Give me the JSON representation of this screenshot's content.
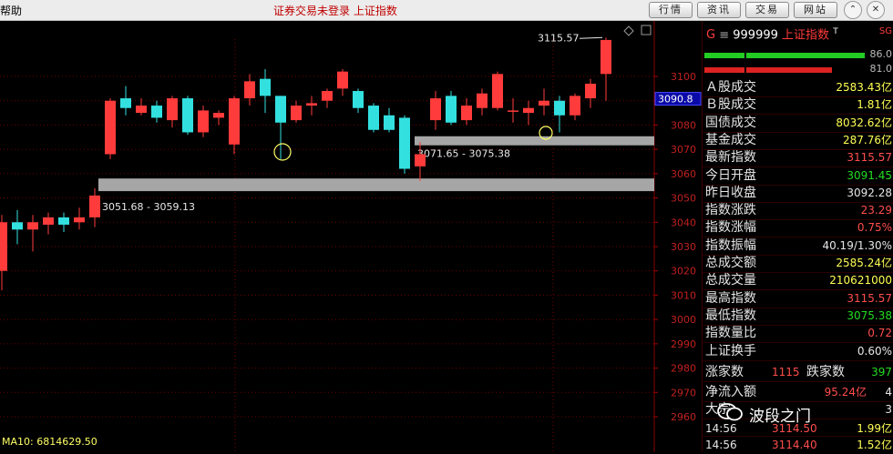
{
  "app": {
    "menu_help": "帮助",
    "status_text": "证券交易未登录 上证指数",
    "buttons": [
      "行情",
      "资讯",
      "交易",
      "网站"
    ]
  },
  "chart": {
    "y_axis_ticks": [
      "3100",
      "3090",
      "3080",
      "3070",
      "3060",
      "3050",
      "3040",
      "3030",
      "3020",
      "3010",
      "3000",
      "2990",
      "2980",
      "2970",
      "2960"
    ],
    "current_price_tag": "3090.8",
    "high_label": "3115.57",
    "zone_labels": [
      "3051.68 - 3059.13",
      "3071.65 - 3075.38"
    ],
    "ma_label": "MA10: 6814629.50",
    "colors": {
      "up": "#ff3b3b",
      "down": "#33e0e0",
      "zone": "#a6a6a6",
      "grid": "#6b0000"
    }
  },
  "chart_data": {
    "type": "candlestick",
    "ylim": [
      2955,
      3120
    ],
    "candles": [
      {
        "o": 3020,
        "c": 3040,
        "h": 3043,
        "l": 3012
      },
      {
        "o": 3040,
        "c": 3037,
        "h": 3045,
        "l": 3031
      },
      {
        "o": 3037,
        "c": 3040,
        "h": 3043,
        "l": 3028
      },
      {
        "o": 3039,
        "c": 3042,
        "h": 3044,
        "l": 3035
      },
      {
        "o": 3042,
        "c": 3039,
        "h": 3044,
        "l": 3036
      },
      {
        "o": 3040,
        "c": 3042,
        "h": 3046,
        "l": 3037
      },
      {
        "o": 3042,
        "c": 3051,
        "h": 3054,
        "l": 3038
      },
      {
        "o": 3068,
        "c": 3090,
        "h": 3091,
        "l": 3066
      },
      {
        "o": 3091,
        "c": 3087,
        "h": 3096,
        "l": 3084
      },
      {
        "o": 3085,
        "c": 3088,
        "h": 3091,
        "l": 3084
      },
      {
        "o": 3088,
        "c": 3083,
        "h": 3090,
        "l": 3081
      },
      {
        "o": 3082,
        "c": 3091,
        "h": 3092,
        "l": 3079
      },
      {
        "o": 3091,
        "c": 3077,
        "h": 3092,
        "l": 3076
      },
      {
        "o": 3077,
        "c": 3086,
        "h": 3088,
        "l": 3075
      },
      {
        "o": 3083,
        "c": 3085,
        "h": 3086,
        "l": 3080
      },
      {
        "o": 3072,
        "c": 3091,
        "h": 3092,
        "l": 3068
      },
      {
        "o": 3091,
        "c": 3098,
        "h": 3101,
        "l": 3088
      },
      {
        "o": 3099,
        "c": 3092,
        "h": 3103,
        "l": 3085
      },
      {
        "o": 3092,
        "c": 3081,
        "h": 3092,
        "l": 3066
      },
      {
        "o": 3082,
        "c": 3088,
        "h": 3090,
        "l": 3081
      },
      {
        "o": 3088,
        "c": 3089,
        "h": 3092,
        "l": 3084
      },
      {
        "o": 3090,
        "c": 3094,
        "h": 3095,
        "l": 3087
      },
      {
        "o": 3095,
        "c": 3102,
        "h": 3103,
        "l": 3092
      },
      {
        "o": 3094,
        "c": 3087,
        "h": 3095,
        "l": 3085
      },
      {
        "o": 3088,
        "c": 3078,
        "h": 3089,
        "l": 3077
      },
      {
        "o": 3084,
        "c": 3078,
        "h": 3087,
        "l": 3077
      },
      {
        "o": 3083,
        "c": 3062,
        "h": 3084,
        "l": 3060
      },
      {
        "o": 3063,
        "c": 3068,
        "h": 3073,
        "l": 3057
      },
      {
        "o": 3082,
        "c": 3091,
        "h": 3094,
        "l": 3078
      },
      {
        "o": 3092,
        "c": 3081,
        "h": 3094,
        "l": 3080
      },
      {
        "o": 3082,
        "c": 3088,
        "h": 3091,
        "l": 3080
      },
      {
        "o": 3087,
        "c": 3093,
        "h": 3095,
        "l": 3084
      },
      {
        "o": 3087,
        "c": 3101,
        "h": 3102,
        "l": 3086
      },
      {
        "o": 3086,
        "c": 3086,
        "h": 3091,
        "l": 3081
      },
      {
        "o": 3085,
        "c": 3087,
        "h": 3090,
        "l": 3080
      },
      {
        "o": 3088,
        "c": 3090,
        "h": 3095,
        "l": 3084
      },
      {
        "o": 3090,
        "c": 3084,
        "h": 3092,
        "l": 3077
      },
      {
        "o": 3084,
        "c": 3092,
        "h": 3093,
        "l": 3082
      },
      {
        "o": 3091,
        "c": 3097,
        "h": 3099,
        "l": 3087
      },
      {
        "o": 3101,
        "c": 3115,
        "h": 3116,
        "l": 3090
      }
    ],
    "zones": [
      {
        "low": 3051.68,
        "high": 3059.13,
        "label": "3051.68 - 3059.13"
      },
      {
        "low": 3071.65,
        "high": 3075.38,
        "label": "3071.65 - 3075.38"
      }
    ]
  },
  "panel": {
    "header": {
      "prefix": "G",
      "menu_icon": "≡",
      "code": "999999",
      "name": "上证指数",
      "superscript": "T",
      "badge": "SG"
    },
    "bars": [
      {
        "value": "86.0"
      },
      {
        "value": "81.0"
      }
    ],
    "rows": [
      {
        "label": "Ａ股成交",
        "value": "2583.43亿",
        "cls": "yl"
      },
      {
        "label": "Ｂ股成交",
        "value": "1.81亿",
        "cls": "yl"
      },
      {
        "label": "国债成交",
        "value": "8032.62亿",
        "cls": "yl"
      },
      {
        "label": "基金成交",
        "value": "287.76亿",
        "cls": "yl"
      },
      {
        "label": "最新指数",
        "value": "3115.57",
        "cls": "up"
      },
      {
        "label": "今日开盘",
        "value": "3091.45",
        "cls": "dn"
      },
      {
        "label": "昨日收盘",
        "value": "3092.28",
        "cls": "nt"
      },
      {
        "label": "指数涨跌",
        "value": "23.29",
        "cls": "up"
      },
      {
        "label": "指数涨幅",
        "value": "0.75%",
        "cls": "up"
      },
      {
        "label": "指数振幅",
        "value": "40.19/1.30%",
        "cls": "nt"
      },
      {
        "label": "总成交额",
        "value": "2585.24亿",
        "cls": "yl"
      },
      {
        "label": "总成交量",
        "value": "210621000",
        "cls": "yl"
      },
      {
        "label": "最高指数",
        "value": "3115.57",
        "cls": "up"
      },
      {
        "label": "最低指数",
        "value": "3075.38",
        "cls": "dn"
      },
      {
        "label": "指数量比",
        "value": "0.72",
        "cls": "up"
      },
      {
        "label": "上证换手",
        "value": "0.60%",
        "cls": "nt"
      }
    ],
    "breadth": {
      "up_label": "涨家数",
      "up_value": "1115",
      "down_label": "跌家数",
      "down_value": "397"
    },
    "flows": [
      {
        "label": "净流入额",
        "value": "95.24亿",
        "extra": "4"
      },
      {
        "label": "大宗",
        "value": "",
        "extra": "3"
      }
    ],
    "ticks": [
      {
        "time": "14:56",
        "price": "3114.50",
        "vol": "1.99亿"
      },
      {
        "time": "14:56",
        "price": "3114.40",
        "vol": "1.52亿"
      }
    ],
    "watermark": "波段之门"
  }
}
